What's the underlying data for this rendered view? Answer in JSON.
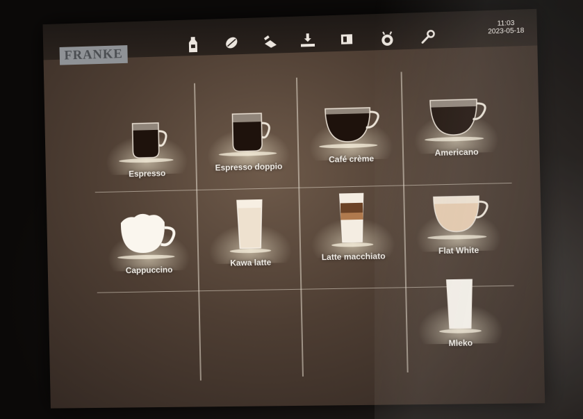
{
  "brand": {
    "logo_text": "FRANKE"
  },
  "toolbar": {
    "icons": [
      "milk-bottle-icon",
      "coffee-bean-icon",
      "cleaning-icon",
      "dispense-icon",
      "grinder-icon",
      "barista-icon",
      "wrench-icon"
    ]
  },
  "status": {
    "time": "11:03",
    "date": "2023-05-18"
  },
  "drinks": [
    {
      "label": "Espresso",
      "kind": "espresso-cup"
    },
    {
      "label": "Espresso doppio",
      "kind": "espresso-cup"
    },
    {
      "label": "Café crème",
      "kind": "wide-cup"
    },
    {
      "label": "Americano",
      "kind": "wide-cup"
    },
    {
      "label": "Cappuccino",
      "kind": "cappuccino-cup"
    },
    {
      "label": "Kawa latte",
      "kind": "latte-glass"
    },
    {
      "label": "Latte macchiato",
      "kind": "macchiato-glass"
    },
    {
      "label": "Flat White",
      "kind": "flatwhite-cup"
    },
    {
      "label": "Mleko",
      "kind": "milk-glass"
    }
  ],
  "colors": {
    "screen_bg": "#5a4a3d",
    "label": "#f3efe9",
    "logo_bg": "#8f9296",
    "coffee": "#1e120c",
    "milk": "#f7f1e6"
  }
}
